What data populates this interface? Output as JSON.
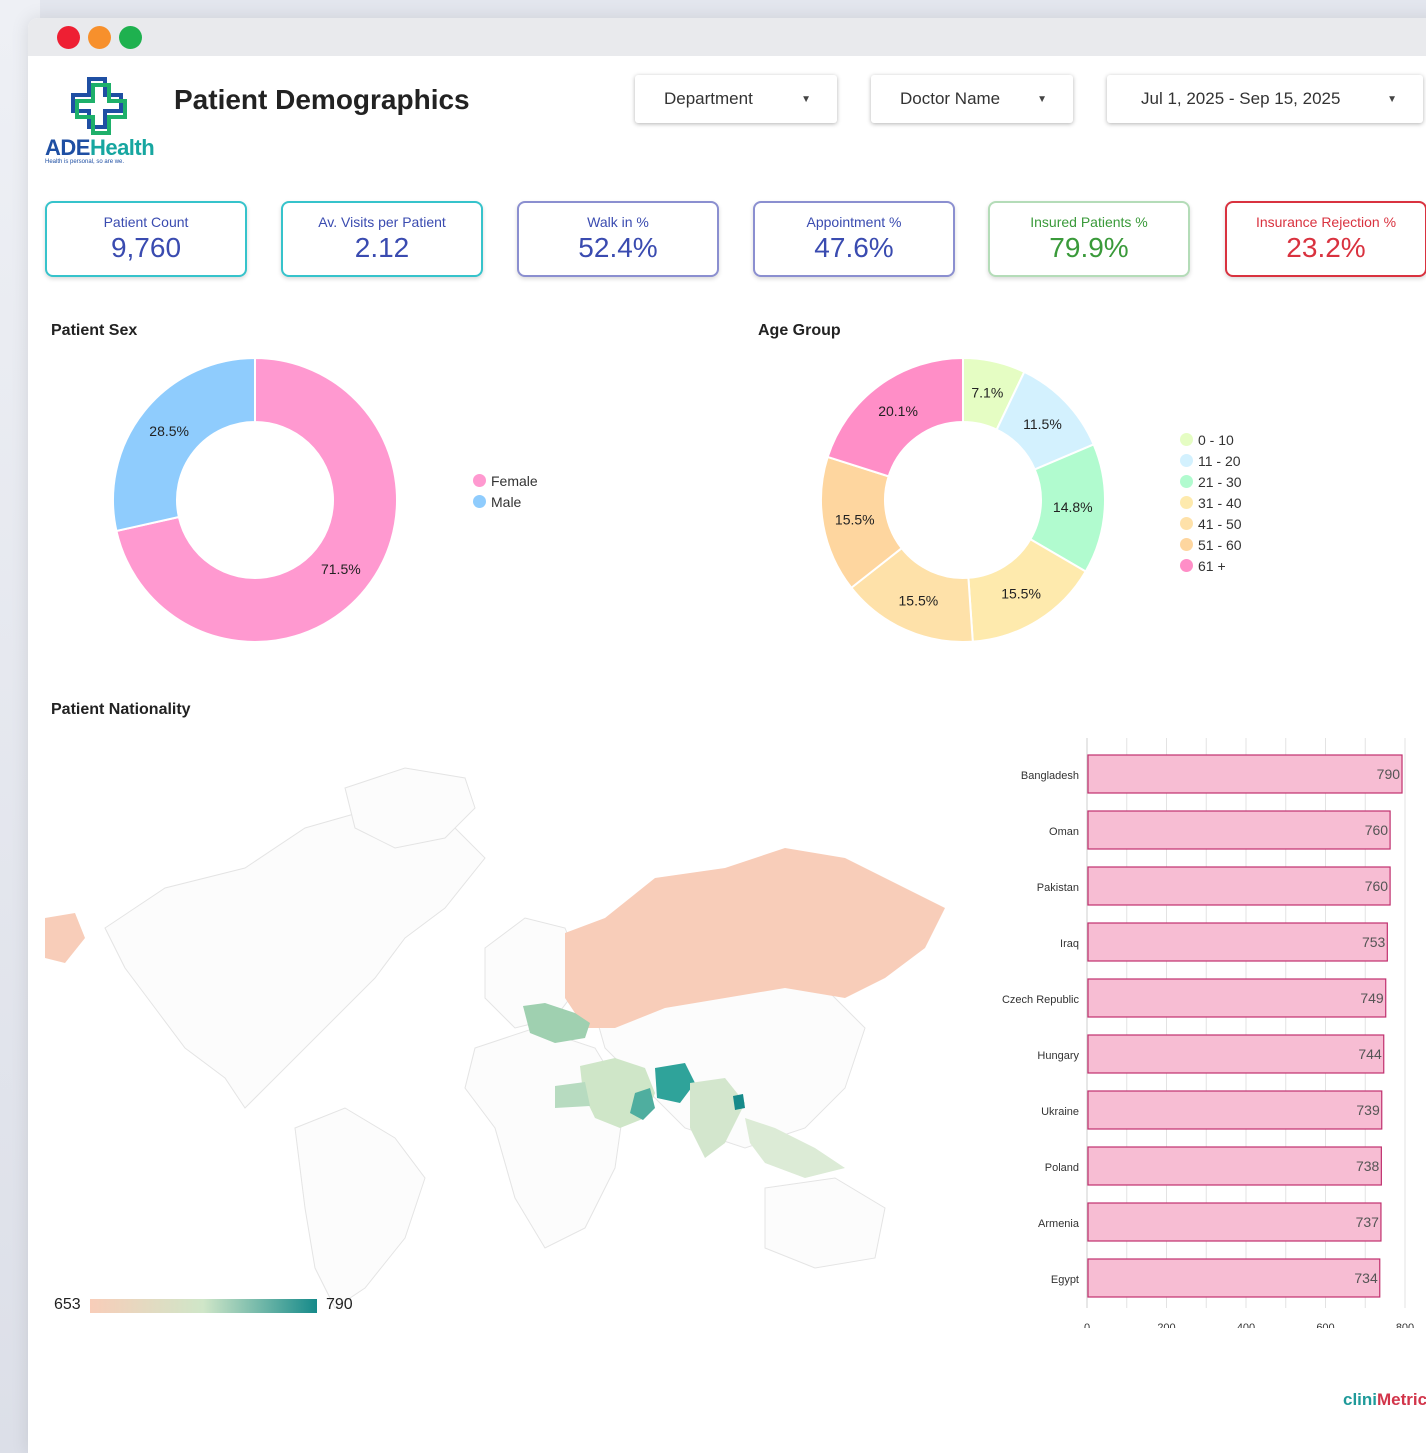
{
  "window": {
    "buttons": [
      "close",
      "minimize",
      "maximize"
    ]
  },
  "header": {
    "logo": {
      "brand_a": "ADE",
      "brand_b": "Health",
      "tagline": "Health is personal, so are we.",
      "icon": "medical-cross-icon"
    },
    "title": "Patient Demographics"
  },
  "filters": [
    {
      "label": "Department"
    },
    {
      "label": "Doctor Name"
    },
    {
      "label": "Jul 1, 2025 - Sep 15, 2025"
    }
  ],
  "kpis": [
    {
      "label": "Patient Count",
      "value": "9,760",
      "color": "#36c3cb",
      "text_color": "#3a4bb0"
    },
    {
      "label": "Av. Visits per Patient",
      "value": "2.12",
      "color": "#36c3cb",
      "text_color": "#3a4bb0"
    },
    {
      "label": "Walk in %",
      "value": "52.4%",
      "color": "#8b8fd0",
      "text_color": "#3a4bb0"
    },
    {
      "label": "Appointment %",
      "value": "47.6%",
      "color": "#8b8fd0",
      "text_color": "#3a4bb0"
    },
    {
      "label": "Insured Patients %",
      "value": "79.9%",
      "color": "#b4dcb8",
      "text_color": "#3a9a3a"
    },
    {
      "label": "Insurance Rejection %",
      "value": "23.2%",
      "color": "#d9323f",
      "text_color": "#d9323f"
    }
  ],
  "sections": {
    "sex": "Patient Sex",
    "age": "Age Group",
    "nationality": "Patient Nationality"
  },
  "map_scale": {
    "min": "653",
    "max": "790",
    "color_low": "#f8cdb9",
    "color_mid": "#cfe6c8",
    "color_high": "#168a8a"
  },
  "brand_footer": {
    "a": "clini",
    "b": "Metric"
  },
  "chart_data": [
    {
      "type": "pie",
      "variant": "donut",
      "title": "Patient Sex",
      "categories": [
        "Female",
        "Male"
      ],
      "values": [
        71.5,
        28.5
      ],
      "labels": [
        "71.5%",
        "28.5%"
      ],
      "colors": [
        "#ff99d0",
        "#8fccfd"
      ],
      "legend": "right"
    },
    {
      "type": "pie",
      "variant": "donut",
      "title": "Age Group",
      "categories": [
        "0 - 10",
        "11 - 20",
        "21 - 30",
        "31 - 40",
        "41 - 50",
        "51 - 60",
        "61 +"
      ],
      "values": [
        7.1,
        11.5,
        14.8,
        15.5,
        15.5,
        15.5,
        20.1
      ],
      "labels": [
        "7.1%",
        "11.5%",
        "14.8%",
        "15.5%",
        "15.5%",
        "15.5%",
        "20.1%"
      ],
      "colors": [
        "#e5fdc3",
        "#d3f1fe",
        "#b1fbcf",
        "#feeaad",
        "#fee1a9",
        "#fed69f",
        "#ff8ec7"
      ],
      "legend": "right"
    },
    {
      "type": "bar",
      "orientation": "horizontal",
      "categories": [
        "Bangladesh",
        "Oman",
        "Pakistan",
        "Iraq",
        "Czech Republic",
        "Hungary",
        "Ukraine",
        "Poland",
        "Armenia",
        "Egypt"
      ],
      "values": [
        790,
        760,
        760,
        753,
        749,
        744,
        739,
        738,
        737,
        734
      ],
      "xlim": [
        0,
        800
      ],
      "xticks": [
        "0",
        "200",
        "400",
        "600",
        "800"
      ],
      "bar_color": "#f7bdd3",
      "bar_border": "#c0306e",
      "grid": true
    }
  ]
}
